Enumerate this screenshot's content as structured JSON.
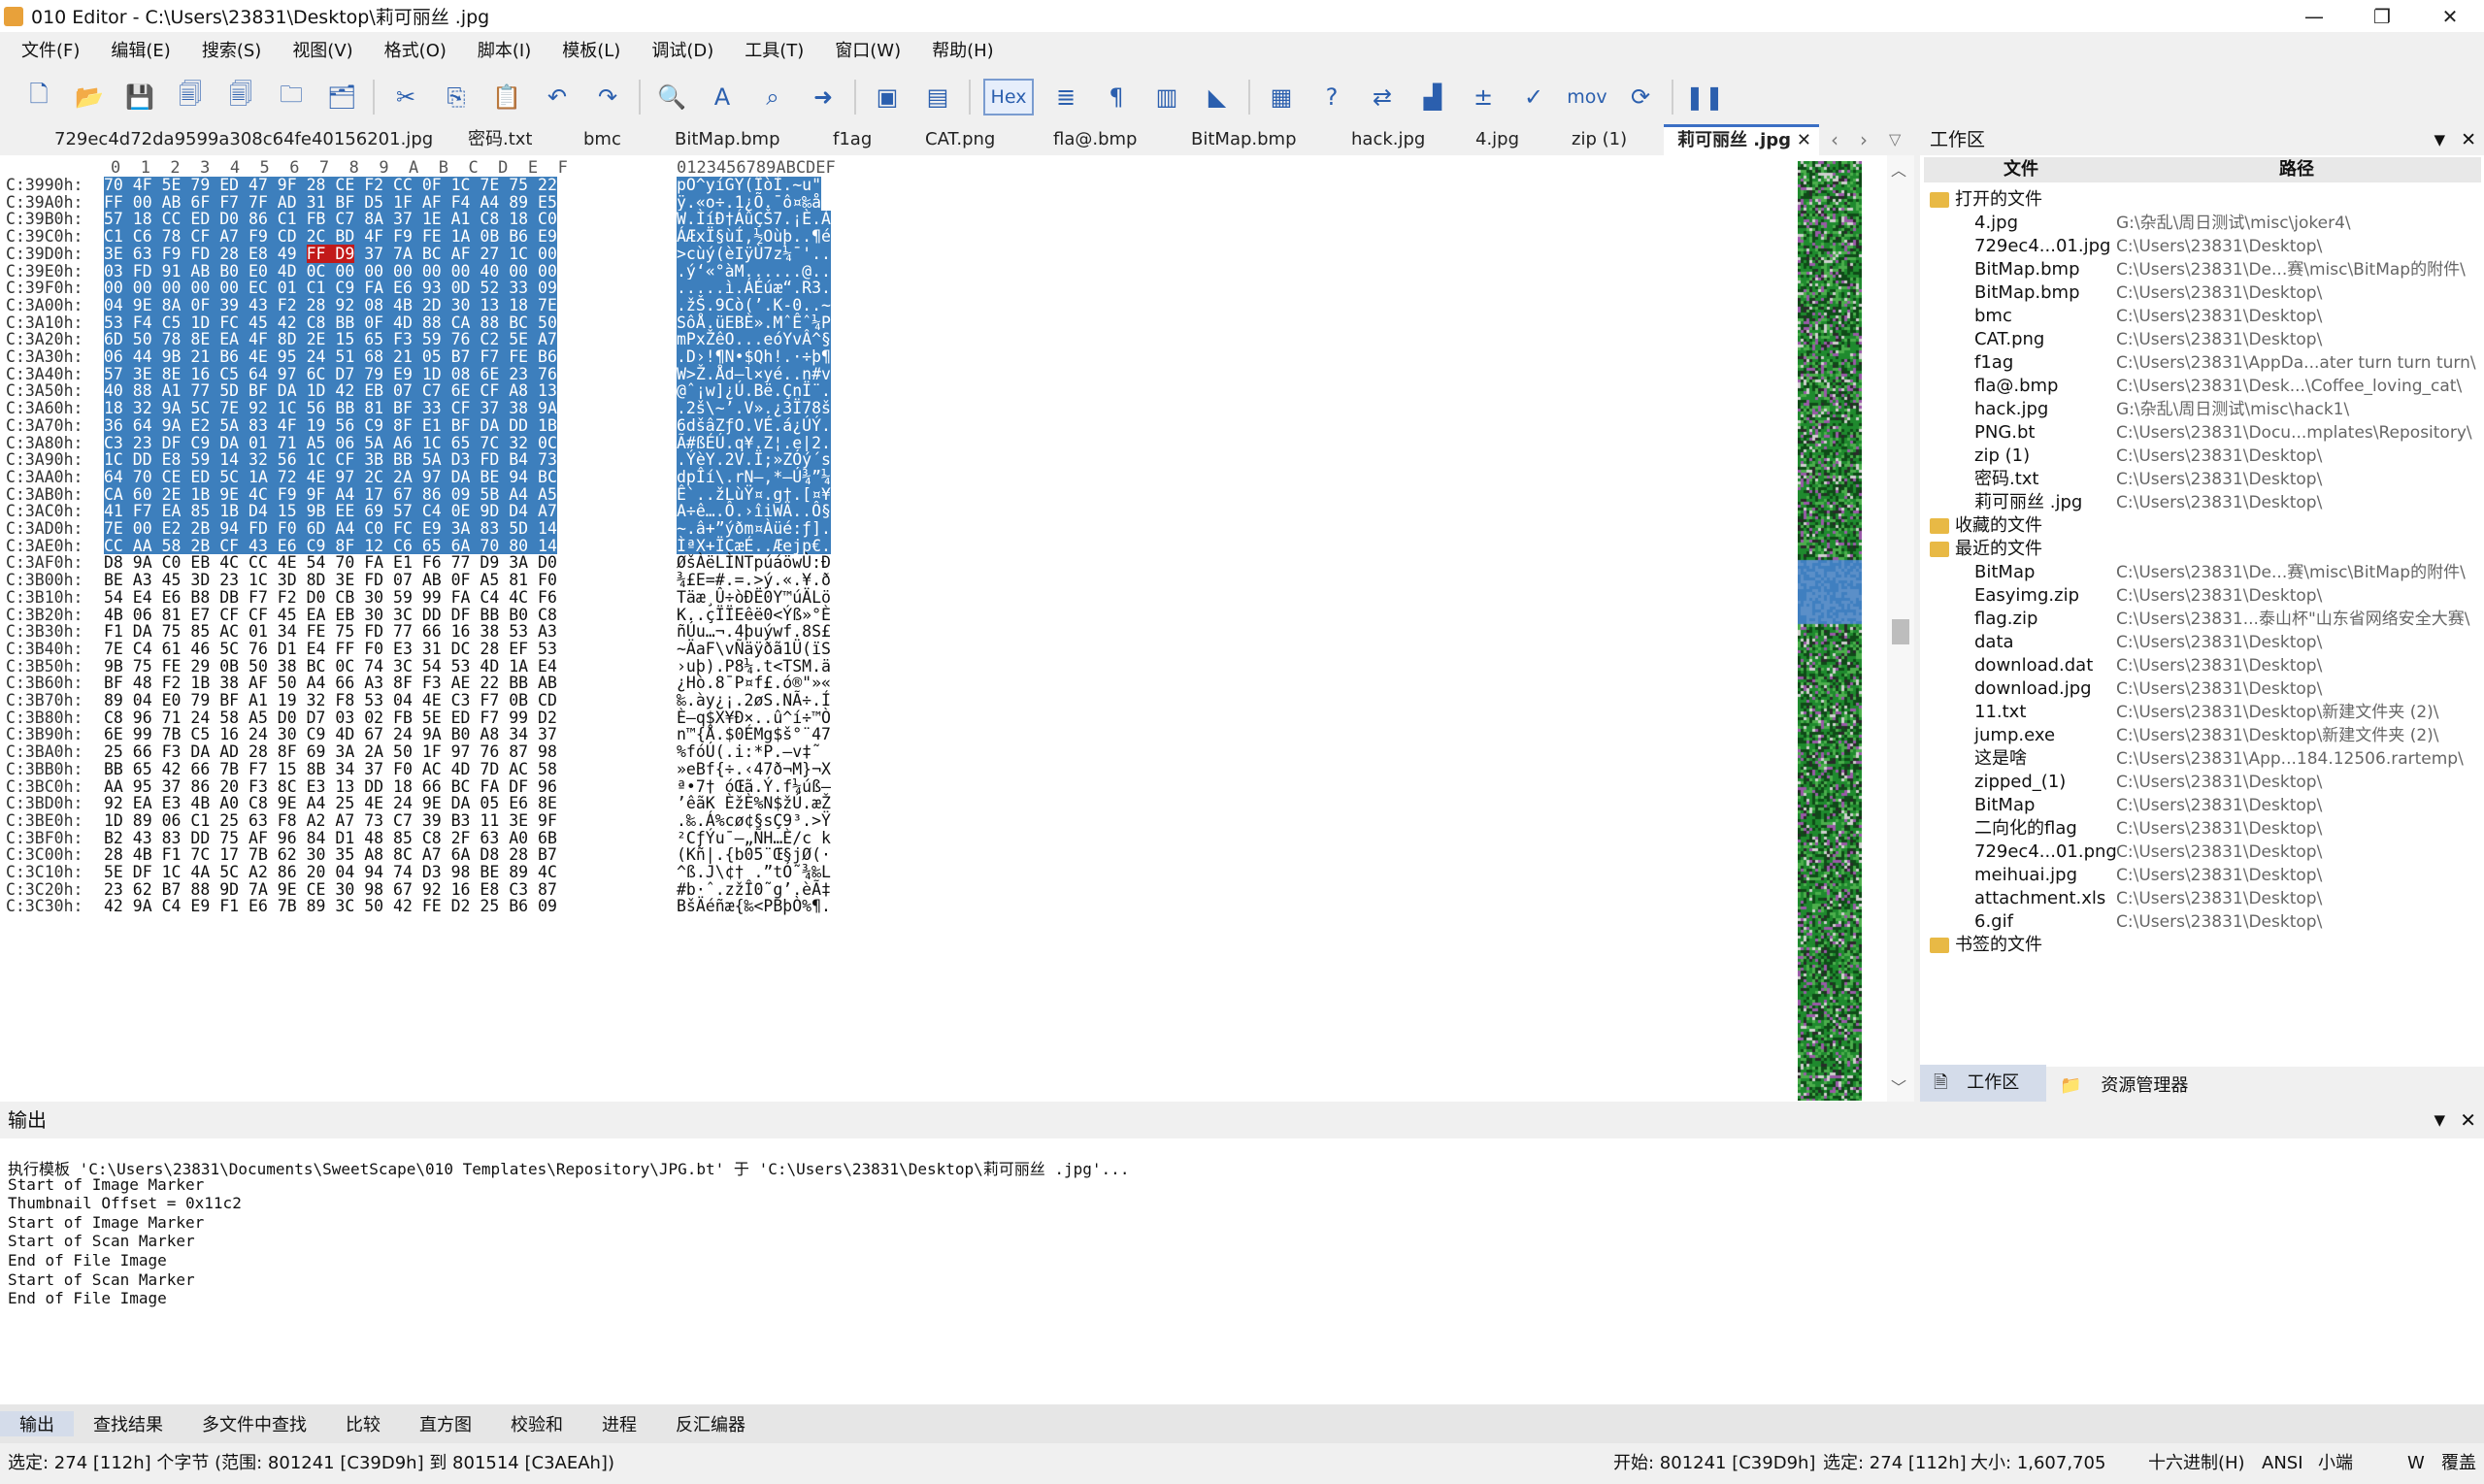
{
  "title": "010 Editor - C:\\Users\\23831\\Desktop\\莉可丽丝 .jpg",
  "window": {
    "min": "—",
    "max": "❐",
    "close": "✕"
  },
  "menu": [
    "文件(F)",
    "编辑(E)",
    "搜索(S)",
    "视图(V)",
    "格式(O)",
    "脚本(I)",
    "模板(L)",
    "调试(D)",
    "工具(T)",
    "窗口(W)",
    "帮助(H)"
  ],
  "toolbar": {
    "hex": "Hex",
    "mov": "mov"
  },
  "tabs": [
    "729ec4d72da9599a308c64fe40156201.jpg",
    "密码.txt",
    "bmc",
    "BitMap.bmp",
    "f1ag",
    "CAT.png",
    "fla@.bmp",
    "BitMap.bmp",
    "hack.jpg",
    "4.jpg",
    "zip (1)",
    "莉可丽丝 .jpg"
  ],
  "hex": {
    "header_hex": "0  1  2  3  4  5  6  7  8  9  A  B  C  D  E  F",
    "header_asc": "0123456789ABCDEF",
    "rows": [
      [
        "C:3990h:",
        "70 4F 5E 79 ED 47 9F 28 CE F2 CC 0F 1C 7E 75 22",
        "pO^yíGŸ(ÎòÌ.~u\""
      ],
      [
        "C:39A0h:",
        "FF 00 AB 6F F7 7F AD 31 BF D5 1F AF F4 A4 89 E5",
        "ÿ.«o÷.­1¿Õ.¯ô¤‰å"
      ],
      [
        "C:39B0h:",
        "57 18 CC ED D0 86 C1 FB C7 8A 37 1E A1 C8 18 C0",
        "W.ÌíÐ†ÁûÇŠ7.¡È.À"
      ],
      [
        "C:39C0h:",
        "C1 C6 78 CF A7 F9 CD 2C BD 4F F9 FE 1A 0B B6 E9",
        "ÁÆxÏ§ùÍ,½Oùþ..¶é"
      ],
      [
        "C:39D0h:",
        "3E 63 F9 FD 28 E8 49 FF D9 37 7A BC AF 27 1C 00",
        ">cùý(èIÿÙ7z¼¯'.."
      ],
      [
        "C:39E0h:",
        "03 FD 91 AB B0 E0 4D 0C 00 00 00 00 00 40 00 00",
        ".ý‘«°àM......@.."
      ],
      [
        "C:39F0h:",
        "00 00 00 00 00 EC 01 C1 C9 FA E6 93 0D 52 33 09",
        ".....ì.ÁÉúæ“.R3."
      ],
      [
        "C:3A00h:",
        "04 9E 8A 0F 39 43 F2 28 92 08 4B 2D 30 13 18 7E",
        ".žŠ.9Cò(’.K-0..~"
      ],
      [
        "C:3A10h:",
        "53 F4 C5 1D FC 45 42 C8 BB 0F 4D 88 CA 88 BC 50",
        "SôÅ.üEBÈ».MˆÊˆ¼P"
      ],
      [
        "C:3A20h:",
        "6D 50 78 8E EA 4F 8D 2E 15 65 F3 59 76 C2 5E A7",
        "mPxŽêO...eóYvÂ^§"
      ],
      [
        "C:3A30h:",
        "06 44 9B 21 B6 4E 95 24 51 68 21 05 B7 F7 FE B6",
        ".D›!¶N•$Qh!.·÷þ¶"
      ],
      [
        "C:3A40h:",
        "57 3E 8E 16 C5 64 97 6C D7 79 E9 1D 08 6E 23 76",
        "W>Ž.Åd—l×yé..n#v"
      ],
      [
        "C:3A50h:",
        "40 88 A1 77 5D BF DA 1D 42 EB 07 C7 6E CF A8 13",
        "@ˆ¡w]¿Ú.Bë.ÇnÏ¨."
      ],
      [
        "C:3A60h:",
        "18 32 9A 5C 7E 92 1C 56 BB 81 BF 33 CF 37 38 9A",
        ".2š\\~’.V».¿3Ï78š"
      ],
      [
        "C:3A70h:",
        "36 64 9A E2 5A 83 4F 19 56 C9 8F E1 BF DA DD 1B",
        "6dšâZƒO.VÉ.á¿ÚÝ."
      ],
      [
        "C:3A80h:",
        "C3 23 DF C9 DA 01 71 A5 06 5A A6 1C 65 7C 32 0C",
        "Ã#ßÉÚ.q¥.Z¦.e|2."
      ],
      [
        "C:3A90h:",
        "1C DD E8 59 14 32 56 1C CF 3B BB 5A D3 FD B4 73",
        ".ÝèY.2V.Ï;»ZÓý´s"
      ],
      [
        "C:3AA0h:",
        "64 70 CE ED 5C 1A 72 4E 97 2C 2A 97 DA BE 94 BC",
        "dpÎí\\.rN—,*—Ú¾”¼"
      ],
      [
        "C:3AB0h:",
        "CA 60 2E 1B 9E 4C F9 9F A4 17 67 86 09 5B A4 A5",
        "Ê`..žLùŸ¤.g†.[¤¥"
      ],
      [
        "C:3AC0h:",
        "41 F7 EA 85 1B D4 15 9B EE 69 57 C4 0E 9D D4 A7",
        "A÷ê….Ô.›îiWÄ..Ô§"
      ],
      [
        "C:3AD0h:",
        "7E 00 E2 2B 94 FD F0 6D A4 C0 FC E9 3A 83 5D 14",
        "~.â+”ýðm¤Àüé:ƒ]."
      ],
      [
        "C:3AE0h:",
        "CC AA 58 2B CF 43 E6 C9 8F 12 C6 65 6A 70 80 14",
        "ÌªX+ÏCæÉ..Æejp€."
      ],
      [
        "C:3AF0h:",
        "D8 9A C0 EB 4C CC 4E 54 70 FA E1 F6 77 D9 3A D0",
        "ØšÀëLÌNTpúáöwÙ:Ð"
      ],
      [
        "C:3B00h:",
        "BE A3 45 3D 23 1C 3D 8D 3E FD 07 AB 0F A5 81 F0",
        "¾£E=#.=.>ý.«.¥.ð"
      ],
      [
        "C:3B10h:",
        "54 E4 E6 B8 DB F7 F2 D0 CB 30 59 99 FA C4 4C F6",
        "Täæ¸Û÷òÐË0Y™úÄLö"
      ],
      [
        "C:3B20h:",
        "4B 06 81 E7 CF CF 45 EA EB 30 3C DD DF BB B0 C8",
        "K..çÏÏEêë0<Ýß»°È"
      ],
      [
        "C:3B30h:",
        "F1 DA 75 85 AC 01 34 FE 75 FD 77 66 16 38 53 A3",
        "ñÚu…¬.4þuýwf.8S£"
      ],
      [
        "C:3B40h:",
        "7E C4 61 46 5C 76 D1 E4 FF F0 E3 31 DC 28 EF 53",
        "~ÄaF\\vÑäÿðã1Ü(ïS"
      ],
      [
        "C:3B50h:",
        "9B 75 FE 29 0B 50 38 BC 0C 74 3C 54 53 4D 1A E4",
        "›uþ).P8¼.t<TSM.ä"
      ],
      [
        "C:3B60h:",
        "BF 48 F2 1B 38 AF 50 A4 66 A3 8F F3 AE 22 BB AB",
        "¿Hò.8¯P¤f£.ó®\"»«"
      ],
      [
        "C:3B70h:",
        "89 04 E0 79 BF A1 19 32 F8 53 04 4E C3 F7 0B CD",
        "‰.ày¿¡.2øS.NÃ÷.Í"
      ],
      [
        "C:3B80h:",
        "C8 96 71 24 58 A5 D0 D7 03 02 FB 5E ED F7 99 D2",
        "È–q$X¥Ð×..û^í÷™Ò"
      ],
      [
        "C:3B90h:",
        "6E 99 7B C5 16 24 30 C9 4D 67 24 9A B0 A8 34 37",
        "n™{Å.$0ÉMg$š°¨47"
      ],
      [
        "C:3BA0h:",
        "25 66 F3 DA AD 28 8F 69 3A 2A 50 1F 97 76 87 98",
        "%fóÚ­(.i:*P.—v‡˜"
      ],
      [
        "C:3BB0h:",
        "BB 65 42 66 7B F7 15 8B 34 37 F0 AC 4D 7D AC 58",
        "»eBf{÷.‹47ð¬M}¬X"
      ],
      [
        "C:3BC0h:",
        "AA 95 37 86 20 F3 8C E3 13 DD 18 66 BC FA DF 96",
        "ª•7† óŒã.Ý.f¼úß–"
      ],
      [
        "C:3BD0h:",
        "92 EA E3 4B A0 C8 9E A4 25 4E 24 9E DA 05 E6 8E",
        "’êãK ÈžÈ%N$žÚ.æŽ"
      ],
      [
        "C:3BE0h:",
        "1D 89 06 C1 25 63 F8 A2 A7 73 C7 39 B3 11 3E 9F",
        ".‰.Á%cø¢§sÇ9³.>Ÿ"
      ],
      [
        "C:3BF0h:",
        "B2 43 83 DD 75 AF 96 84 D1 48 85 C8 2F 63 A0 6B",
        "²CƒÝu¯–„ÑH…È/c k"
      ],
      [
        "C:3C00h:",
        "28 4B F1 7C 17 7B 62 30 35 A8 8C A7 6A D8 28 B7",
        "(Kñ|.{b05¨Œ§jØ(·"
      ],
      [
        "C:3C10h:",
        "5E DF 1C 4A 5C A2 86 20 04 94 74 D3 98 BE 89 4C",
        "^ß.J\\¢† .”tÓ˜¾‰L"
      ],
      [
        "C:3C20h:",
        "23 62 B7 88 9D 7A 9E CE 30 98 67 92 16 E8 C3 87",
        "#b·ˆ.zžÎ0˜g’.èÃ‡"
      ],
      [
        "C:3C30h:",
        "42 9A C4 E9 F1 E6 7B 89 3C 50 42 FE D2 25 B6 09",
        "BšÄéñæ{‰<PBþÒ%¶."
      ]
    ]
  },
  "workspace": {
    "title": "工作区",
    "col_file": "文件",
    "col_path": "路径",
    "groups": {
      "open": "打开的文件",
      "fav": "收藏的文件",
      "recent": "最近的文件",
      "bookmark": "书签的文件"
    },
    "open_files": [
      [
        "4.jpg",
        "G:\\杂乱\\周日测试\\misc\\joker4\\"
      ],
      [
        "729ec4...01.jpg",
        "C:\\Users\\23831\\Desktop\\"
      ],
      [
        "BitMap.bmp",
        "C:\\Users\\23831\\De...赛\\misc\\BitMap的附件\\"
      ],
      [
        "BitMap.bmp",
        "C:\\Users\\23831\\Desktop\\"
      ],
      [
        "bmc",
        "C:\\Users\\23831\\Desktop\\"
      ],
      [
        "CAT.png",
        "C:\\Users\\23831\\Desktop\\"
      ],
      [
        "f1ag",
        "C:\\Users\\23831\\AppDa...ater turn turn turn\\"
      ],
      [
        "fla@.bmp",
        "C:\\Users\\23831\\Desk...\\Coffee_loving_cat\\"
      ],
      [
        "hack.jpg",
        "G:\\杂乱\\周日测试\\misc\\hack1\\"
      ],
      [
        "PNG.bt",
        "C:\\Users\\23831\\Docu...mplates\\Repository\\"
      ],
      [
        "zip (1)",
        "C:\\Users\\23831\\Desktop\\"
      ],
      [
        "密码.txt",
        "C:\\Users\\23831\\Desktop\\"
      ],
      [
        "莉可丽丝 .jpg",
        "C:\\Users\\23831\\Desktop\\"
      ]
    ],
    "recent_files": [
      [
        "BitMap",
        "C:\\Users\\23831\\De...赛\\misc\\BitMap的附件\\"
      ],
      [
        "Easyimg.zip",
        "C:\\Users\\23831\\Desktop\\"
      ],
      [
        "flag.zip",
        "C:\\Users\\23831...泰山杯\"山东省网络安全大赛\\"
      ],
      [
        "data",
        "C:\\Users\\23831\\Desktop\\"
      ],
      [
        "download.dat",
        "C:\\Users\\23831\\Desktop\\"
      ],
      [
        "download.jpg",
        "C:\\Users\\23831\\Desktop\\"
      ],
      [
        "11.txt",
        "C:\\Users\\23831\\Desktop\\新建文件夹 (2)\\"
      ],
      [
        "jump.exe",
        "C:\\Users\\23831\\Desktop\\新建文件夹 (2)\\"
      ],
      [
        "这是啥",
        "C:\\Users\\23831\\App...184.12506.rartemp\\"
      ],
      [
        "zipped_(1)",
        "C:\\Users\\23831\\Desktop\\"
      ],
      [
        "BitMap",
        "C:\\Users\\23831\\Desktop\\"
      ],
      [
        "二向化的flag",
        "C:\\Users\\23831\\Desktop\\"
      ],
      [
        "729ec4...01.png",
        "C:\\Users\\23831\\Desktop\\"
      ],
      [
        "meihuai.jpg",
        "C:\\Users\\23831\\Desktop\\"
      ],
      [
        "attachment.xls",
        "C:\\Users\\23831\\Desktop\\"
      ],
      [
        "6.gif",
        "C:\\Users\\23831\\Desktop\\"
      ]
    ],
    "footer_tabs": [
      "工作区",
      "资源管理器"
    ]
  },
  "output": {
    "title": "输出",
    "lines": [
      "执行模板 'C:\\Users\\23831\\Documents\\SweetScape\\010 Templates\\Repository\\JPG.bt' 于 'C:\\Users\\23831\\Desktop\\莉可丽丝 .jpg'...",
      "Start of Image Marker",
      "Thumbnail Offset = 0x11c2",
      "Start of Image Marker",
      "Start of Scan Marker",
      "End of File Image",
      "Start of Scan Marker",
      "End of File Image"
    ]
  },
  "bottom_tabs": [
    "输出",
    "查找结果",
    "多文件中查找",
    "比较",
    "直方图",
    "校验和",
    "进程",
    "反汇编器"
  ],
  "status": {
    "left": "选定: 274 [112h] 个字节 (范围: 801241 [C39D9h] 到 801514 [C3AEAh])",
    "start": "开始: 801241 [C39D9h]",
    "sel": "选定: 274 [112h]",
    "size": "大小: 1,607,705",
    "mode": "十六进制(H)",
    "enc": "ANSI",
    "endian": "小端",
    "w": "W",
    "ovr": "覆盖"
  }
}
